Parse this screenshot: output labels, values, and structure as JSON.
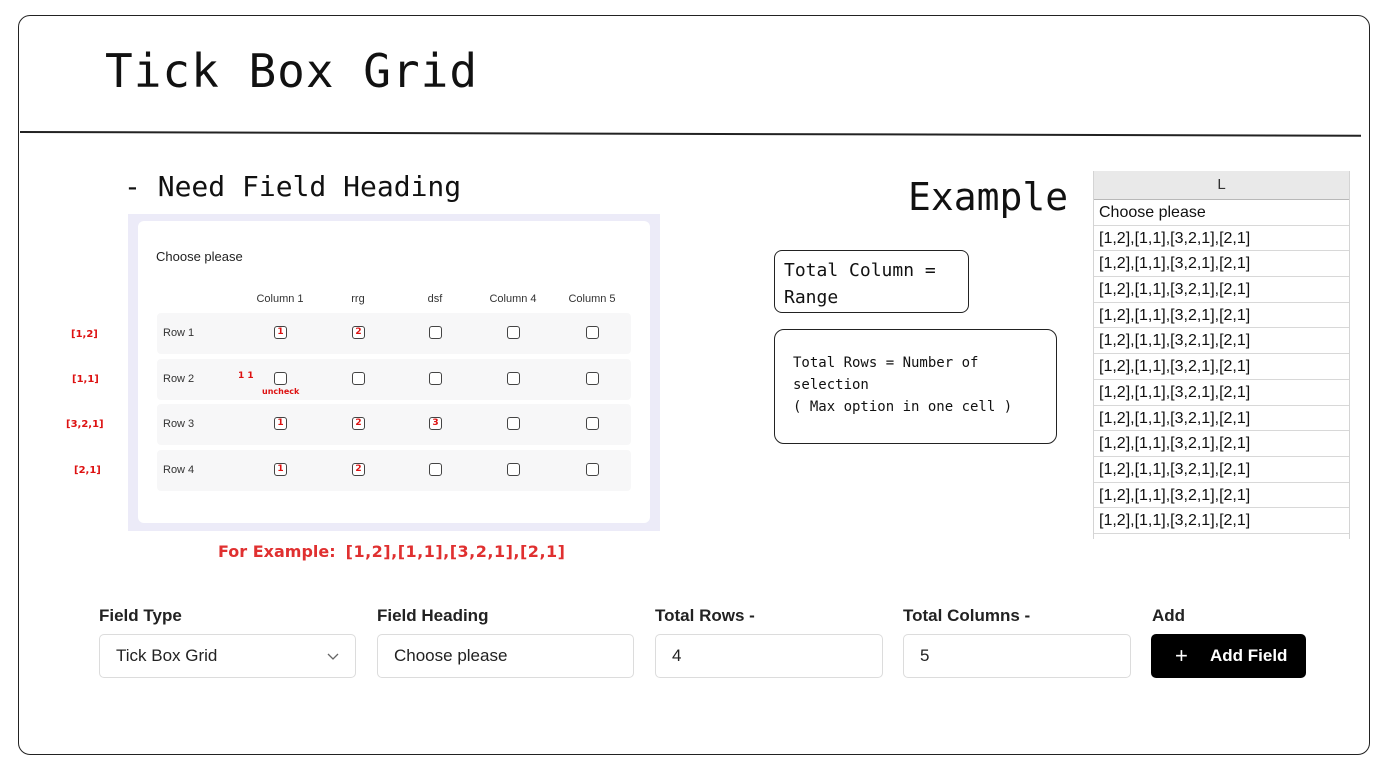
{
  "title": "Tick Box Grid",
  "heading_note": "- Need Field Heading",
  "grid": {
    "question": "Choose please",
    "columns": [
      "Column 1",
      "rrg",
      "dsf",
      "Column 4",
      "Column 5"
    ],
    "rows": [
      {
        "label": "Row 1",
        "tag": "[1,2]",
        "cells": [
          "1",
          "2",
          "",
          "",
          ""
        ]
      },
      {
        "label": "Row 2",
        "tag": "[1,1]",
        "cells": [
          "",
          "",
          "",
          "",
          ""
        ]
      },
      {
        "label": "Row 3",
        "tag": "[3,2,1]",
        "cells": [
          "1",
          "2",
          "3",
          "",
          ""
        ]
      },
      {
        "label": "Row 4",
        "tag": "[2,1]",
        "cells": [
          "1",
          "2",
          "",
          "",
          ""
        ]
      }
    ],
    "row2_annotation": "1 1",
    "uncheck_note": "uncheck"
  },
  "for_example": {
    "label": "For Example:",
    "value": "[1,2],[1,1],[3,2,1],[2,1]"
  },
  "example_label": "Example",
  "note_columns": "Total Column = Range",
  "note_rows": "Total Rows = Number of selection\n( Max option in one cell )",
  "sheet": {
    "column_header": "L",
    "cells": [
      "Choose please",
      "[1,2],[1,1],[3,2,1],[2,1]",
      "[1,2],[1,1],[3,2,1],[2,1]",
      "[1,2],[1,1],[3,2,1],[2,1]",
      "[1,2],[1,1],[3,2,1],[2,1]",
      "[1,2],[1,1],[3,2,1],[2,1]",
      "[1,2],[1,1],[3,2,1],[2,1]",
      "[1,2],[1,1],[3,2,1],[2,1]",
      "[1,2],[1,1],[3,2,1],[2,1]",
      "[1,2],[1,1],[3,2,1],[2,1]",
      "[1,2],[1,1],[3,2,1],[2,1]",
      "[1,2],[1,1],[3,2,1],[2,1]",
      "[1,2],[1,1],[3,2,1],[2,1]"
    ]
  },
  "form": {
    "field_type_label": "Field Type",
    "field_type_value": "Tick Box Grid",
    "field_heading_label": "Field Heading",
    "field_heading_value": "Choose please",
    "total_rows_label": "Total Rows -",
    "total_rows_value": "4",
    "total_columns_label": "Total Columns -",
    "total_columns_value": "5",
    "add_label": "Add",
    "add_button": "Add Field",
    "add_icon": "plus-icon",
    "chevron_icon": "chevron-down-icon"
  },
  "colors": {
    "annotation_red": "#d11111",
    "grid_bg": "#ecebf8",
    "button_bg": "#000000"
  }
}
